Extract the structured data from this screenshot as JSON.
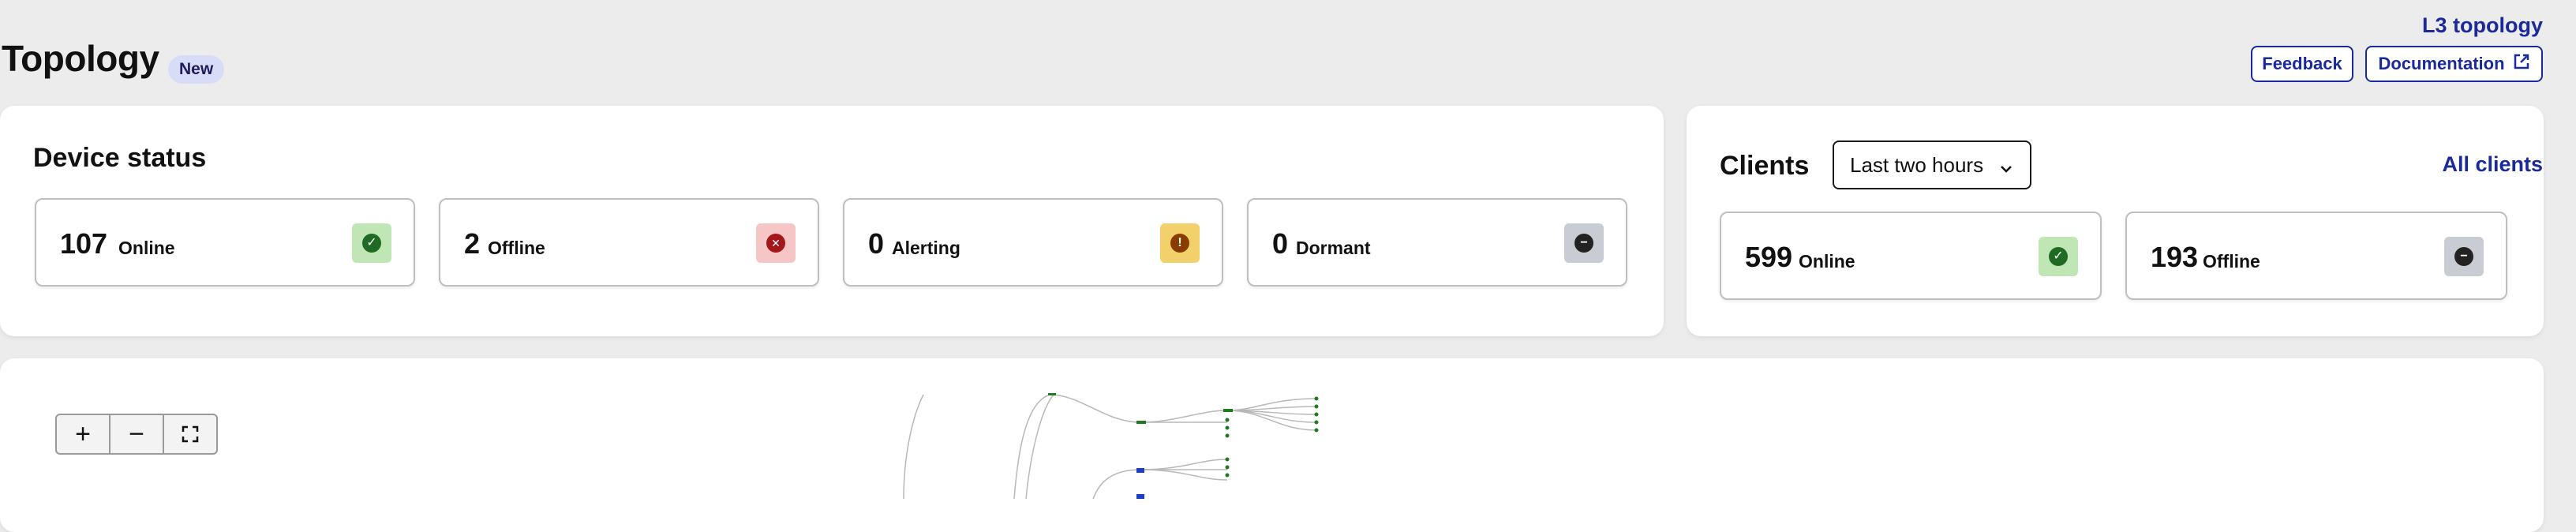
{
  "header": {
    "title": "Topology",
    "badge": "New",
    "l3_link": "L3 topology",
    "feedback_label": "Feedback",
    "documentation_label": "Documentation"
  },
  "device_status": {
    "title": "Device status",
    "tiles": [
      {
        "count": "107",
        "label": "Online",
        "icon": "check-circle-icon",
        "color": "#2e7d32",
        "bg": "#bfe6b4"
      },
      {
        "count": "2",
        "label": "Offline",
        "icon": "x-circle-icon",
        "color": "#b3261e",
        "bg": "#f6c6c6"
      },
      {
        "count": "0",
        "label": "Alerting",
        "icon": "alert-circle-icon",
        "color": "#8a4b00",
        "bg": "#f2d06a"
      },
      {
        "count": "0",
        "label": "Dormant",
        "icon": "minus-circle-icon",
        "color": "#2a2a2a",
        "bg": "#c9ccd3"
      }
    ]
  },
  "clients": {
    "title": "Clients",
    "range_selected": "Last two hours",
    "all_link": "All clients",
    "tiles": [
      {
        "count": "599",
        "label": "Online",
        "icon": "check-circle-icon",
        "color": "#2e7d32",
        "bg": "#bfe6b4"
      },
      {
        "count": "193",
        "label": "Offline",
        "icon": "minus-circle-icon",
        "color": "#2a2a2a",
        "bg": "#c9ccd3"
      }
    ]
  },
  "map_controls": {
    "zoom_in": "+",
    "zoom_out": "−"
  },
  "colors": {
    "accent": "#1a2a9c",
    "node_green": "#1f7a1f",
    "node_blue": "#1a3fc4"
  }
}
